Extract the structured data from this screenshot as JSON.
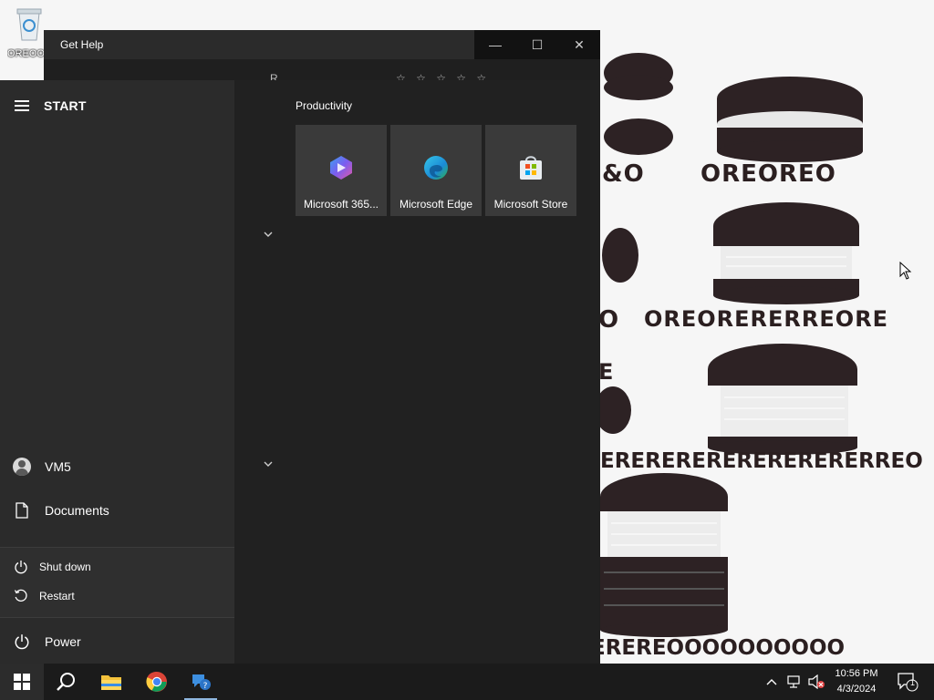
{
  "desktop": {
    "recycle_bin_label": "OREOOO",
    "wallpaper_words": [
      "&O",
      "OREOREO",
      "O",
      "OREORERERREORE",
      "E",
      "ERERERERERERERERERREO",
      "EREREOOOOOOOOOO"
    ]
  },
  "get_help_window": {
    "title": "Get Help",
    "minimize_label": "—",
    "maximize_label": "☐",
    "close_label": "✕",
    "partial_row_text": "R",
    "rating_stars": "☆ ☆ ☆ ☆ ☆"
  },
  "start_menu": {
    "header_label": "START",
    "user_name": "VM5",
    "documents_label": "Documents",
    "power_label": "Power",
    "power_options": [
      {
        "label": "Shut down",
        "icon": "power-icon"
      },
      {
        "label": "Restart",
        "icon": "restart-icon"
      }
    ],
    "group_title": "Productivity",
    "tiles": [
      {
        "label": "Microsoft 365...",
        "icon": "microsoft-365-icon"
      },
      {
        "label": "Microsoft Edge",
        "icon": "edge-icon"
      },
      {
        "label": "Microsoft Store",
        "icon": "store-icon"
      }
    ]
  },
  "taskbar": {
    "apps": [
      "start-button",
      "search-icon",
      "file-explorer-icon",
      "chrome-icon",
      "get-help-icon"
    ],
    "time": "10:56 PM",
    "date": "4/3/2024",
    "notification_count": "1"
  },
  "colors": {
    "start_bg": "#212121",
    "left_pane_bg": "#2b2b2b",
    "tile_bg": "#3a3a3a",
    "taskbar_bg": "#1b1b1b",
    "accent": "#0078d4"
  }
}
